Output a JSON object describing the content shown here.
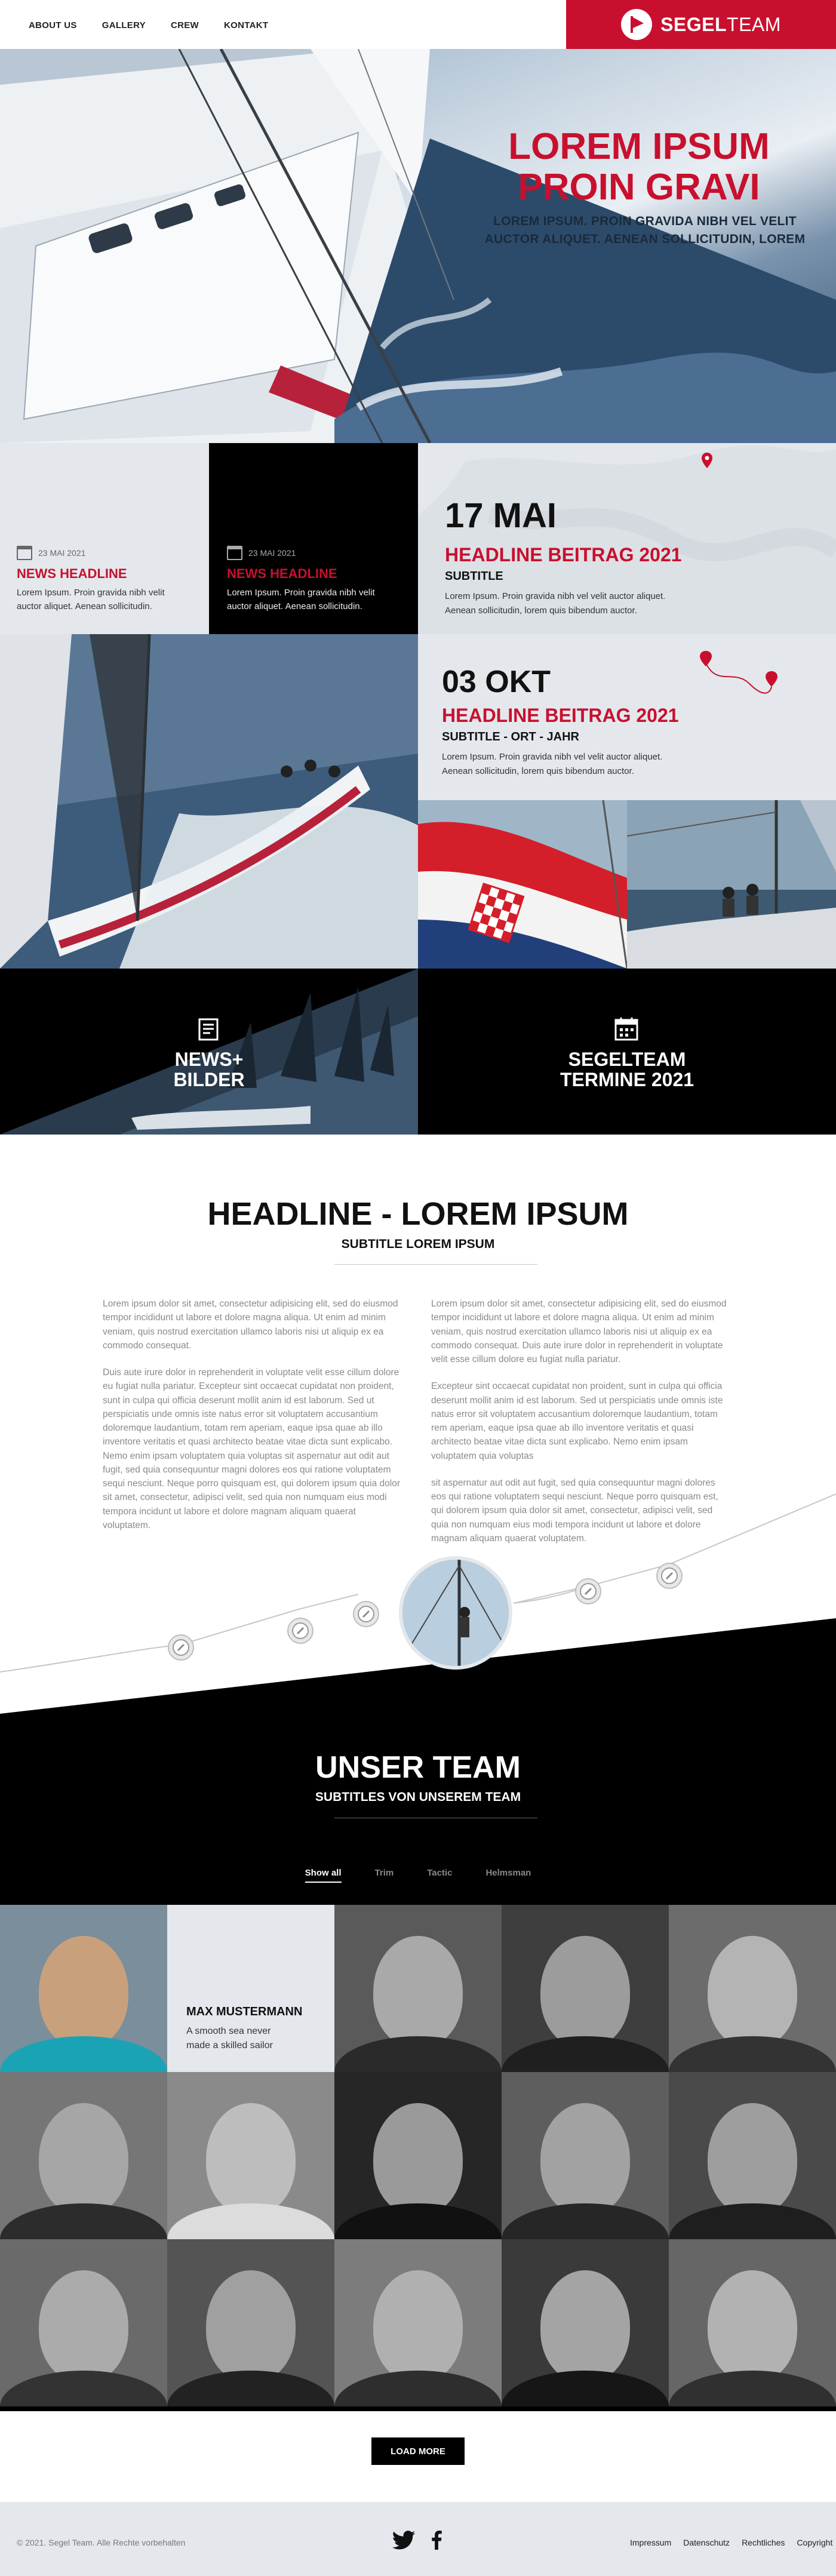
{
  "nav": {
    "items": [
      "ABOUT US",
      "GALLERY",
      "CREW",
      "KONTAKT"
    ]
  },
  "brand": {
    "bold": "SEGEL",
    "light": "TEAM"
  },
  "hero": {
    "title_line1": "LOREM IPSUM",
    "title_line2": "PROIN GRAVI",
    "sub_line1": "LOREM IPSUM. PROIN GRAVIDA NIBH VEL VELIT",
    "sub_line2": "AUCTOR ALIQUET.  AENEAN SOLLICITUDIN, LOREM"
  },
  "news": [
    {
      "date": "23 MAI 2021",
      "title": "NEWS HEADLINE",
      "body_line1": "Lorem Ipsum. Proin gravida nibh velit",
      "body_line2": "auctor aliquet. Aenean sollicitudin."
    },
    {
      "date": "23 MAI 2021",
      "title": "NEWS HEADLINE",
      "body_line1": "Lorem Ipsum. Proin gravida nibh velit",
      "body_line2": "auctor aliquet. Aenean sollicitudin."
    }
  ],
  "events": [
    {
      "date": "17 MAI",
      "headline": "HEADLINE BEITRAG 2021",
      "subtitle": "SUBTITLE",
      "body_line1": "Lorem Ipsum. Proin gravida nibh vel velit auctor aliquet.",
      "body_line2": "Aenean sollicitudin, lorem quis bibendum auctor."
    },
    {
      "date": "03 OKT",
      "headline": "HEADLINE BEITRAG 2021",
      "subtitle": "SUBTITLE - ORT - JAHR",
      "body_line1": "Lorem Ipsum. Proin gravida nibh vel velit auctor aliquet.",
      "body_line2": "Aenean sollicitudin, lorem quis bibendum auctor."
    }
  ],
  "tiles": {
    "news_line1": "NEWS+",
    "news_line2": "BILDER",
    "termine_line1": "SEGELTEAM",
    "termine_line2": "TERMINE 2021"
  },
  "content": {
    "headline": "HEADLINE - LOREM IPSUM",
    "subtitle": "SUBTITLE LOREM IPSUM",
    "left_p1": "Lorem ipsum dolor sit amet, consectetur adipisicing elit, sed do eiusmod tempor incididunt ut labore et dolore magna aliqua. Ut enim ad minim veniam, quis nostrud exercitation ullamco laboris nisi ut aliquip ex ea commodo consequat.",
    "left_p2": "Duis aute irure dolor in reprehenderit in voluptate velit esse cillum dolore eu fugiat nulla pariatur. Excepteur sint occaecat cupidatat non proident, sunt in culpa qui officia deserunt mollit anim id est laborum. Sed ut perspiciatis unde omnis iste natus error sit voluptatem accusantium doloremque laudantium, totam rem aperiam, eaque ipsa quae ab illo inventore veritatis et quasi architecto beatae vitae dicta sunt explicabo. Nemo enim ipsam voluptatem quia voluptas sit aspernatur aut odit aut fugit, sed quia consequuntur magni dolores eos qui ratione voluptatem sequi nesciunt. Neque porro quisquam est, qui dolorem ipsum quia dolor sit amet, consectetur, adipisci velit, sed quia non numquam eius modi tempora incidunt ut labore et dolore magnam aliquam quaerat voluptatem.",
    "right_p1": "Lorem ipsum dolor sit amet, consectetur adipisicing elit, sed do eiusmod tempor incididunt ut labore et dolore magna aliqua. Ut enim ad minim veniam, quis nostrud exercitation ullamco laboris nisi ut aliquip ex ea commodo consequat. Duis aute irure dolor in reprehenderit in voluptate velit esse cillum dolore eu fugiat nulla pariatur.",
    "right_p2": "Excepteur sint occaecat cupidatat non proident, sunt in culpa qui officia deserunt mollit anim id est laborum. Sed ut perspiciatis unde omnis iste natus error sit voluptatem accusantium doloremque laudantium, totam rem aperiam, eaque ipsa quae ab illo inventore veritatis et quasi architecto beatae vitae dicta sunt explicabo. Nemo enim ipsam voluptatem quia voluptas",
    "right_p3": "sit aspernatur aut odit aut fugit, sed quia consequuntur magni dolores eos qui ratione voluptatem sequi nesciunt. Neque porro quisquam est, qui dolorem ipsum quia dolor sit amet, consectetur, adipisci velit, sed quia non numquam eius modi tempora incidunt ut labore et dolore magnam aliquam quaerat voluptatem."
  },
  "team": {
    "title": "UNSER TEAM",
    "subtitle": "SUBTITLES VON UNSEREM TEAM",
    "filters": [
      "Show all",
      "Trim",
      "Tactic",
      "Helmsman"
    ],
    "featured": {
      "name": "MAX MUSTERMANN",
      "bio_line1": "A smooth sea never",
      "bio_line2": "made a skilled sailor"
    },
    "load_more": "LOAD MORE"
  },
  "footer": {
    "copyright": "© 2021. Segel Team. Alle Rechte vorbehalten",
    "links": [
      "Impressum",
      "Datenschutz",
      "Rechtliches",
      "Copyright"
    ]
  },
  "colors": {
    "accent": "#c8102e",
    "dark": "#000000",
    "light_grey": "#e4e8ec"
  }
}
